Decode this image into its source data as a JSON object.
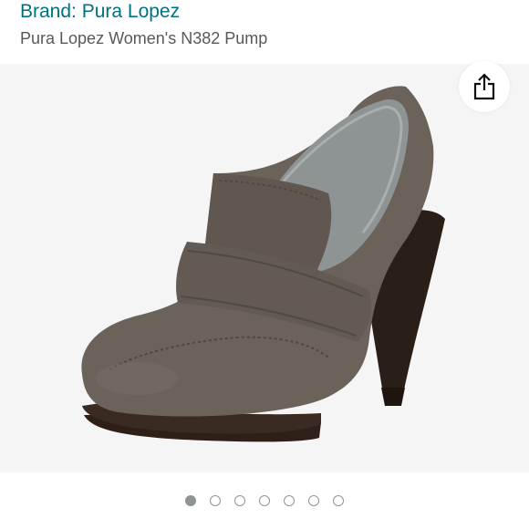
{
  "header": {
    "brand_link": "Brand: Pura Lopez",
    "product_title": "Pura Lopez Women's N382 Pump"
  },
  "image": {
    "subject": "gray suede loafer-style platform pump",
    "colors": {
      "suede": "#6b625a",
      "sole": "#2a1e18",
      "lining": "#8e9493",
      "background": "#f5f5f5"
    }
  },
  "share": {
    "icon": "share-icon"
  },
  "carousel": {
    "total": 7,
    "active_index": 0
  },
  "colors": {
    "link": "#007185",
    "title": "#565959",
    "dot": "#8f9494"
  }
}
